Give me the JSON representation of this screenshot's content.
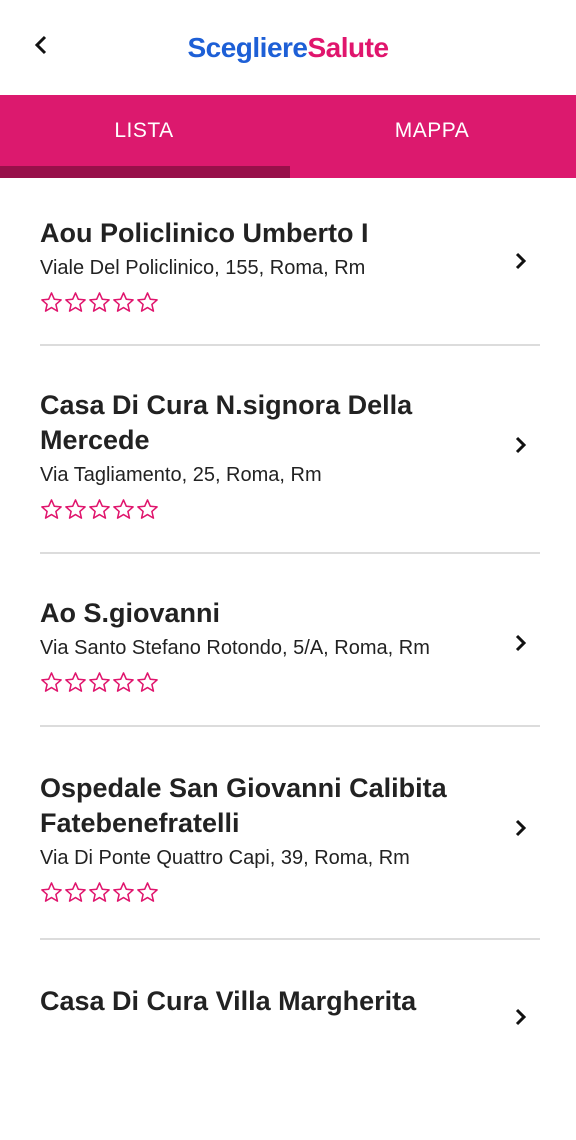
{
  "header": {
    "logo_part1": "Scegliere",
    "logo_part2": "Salute",
    "back_icon": "chevron-left-icon"
  },
  "tabs": [
    {
      "label": "LISTA",
      "selected": true
    },
    {
      "label": "MAPPA",
      "selected": false
    }
  ],
  "colors": {
    "brand_pink": "#dc196e",
    "tab_indicator": "#98104a",
    "logo_blue": "#1d5fd6",
    "logo_pink": "#e0156d",
    "star_outline": "#e0156d"
  },
  "hospitals": [
    {
      "name": "Aou Policlinico Umberto I",
      "address": "Viale Del Policlinico, 155, Roma, Rm",
      "rating": 0,
      "max_rating": 5
    },
    {
      "name": "Casa Di Cura N.signora Della Mercede",
      "address": "Via Tagliamento, 25, Roma, Rm",
      "rating": 0,
      "max_rating": 5
    },
    {
      "name": "Ao S.giovanni",
      "address": "Via Santo Stefano Rotondo, 5/A, Roma, Rm",
      "rating": 0,
      "max_rating": 5
    },
    {
      "name": "Ospedale San Giovanni Calibita Fatebenefratelli",
      "address": "Via Di Ponte Quattro Capi, 39, Roma, Rm",
      "rating": 0,
      "max_rating": 5
    },
    {
      "name": "Casa Di Cura Villa Margherita",
      "address": "",
      "rating": 0,
      "max_rating": 5
    }
  ]
}
